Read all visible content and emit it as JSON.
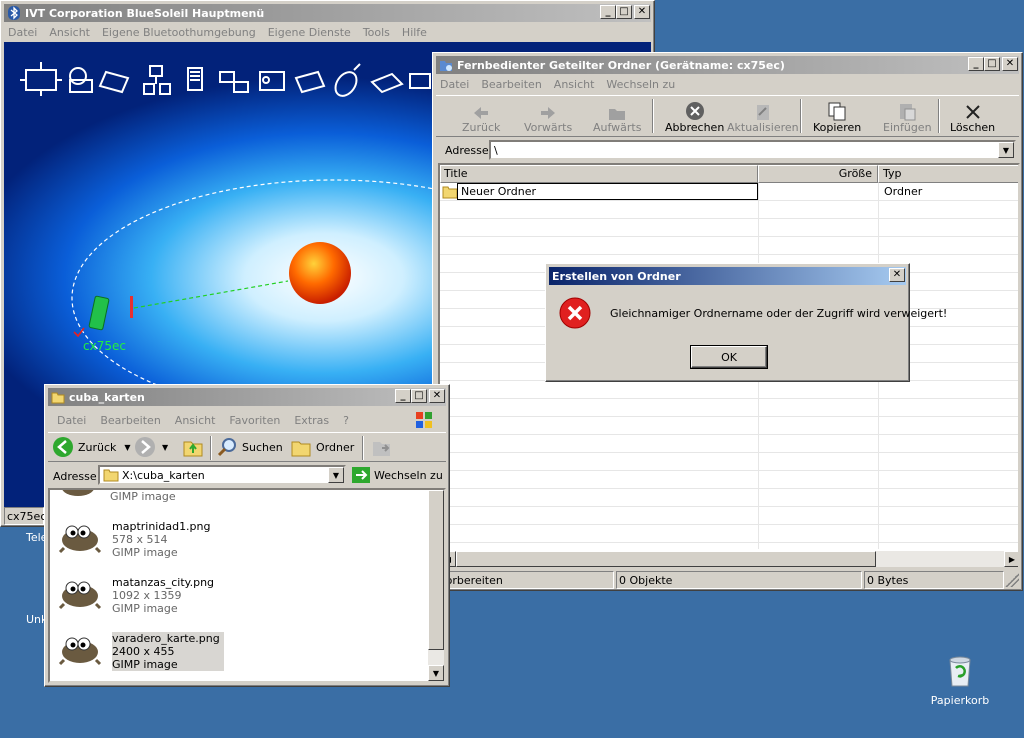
{
  "desktop": {
    "labels": [
      "Tele",
      "Unk"
    ],
    "recycle_bin": "Papierkorb"
  },
  "bluesoleil": {
    "title": "IVT Corporation BlueSoleil Hauptmenü",
    "menu": [
      "Datei",
      "Ansicht",
      "Eigene Bluetoothumgebung",
      "Eigene Dienste",
      "Tools",
      "Hilfe"
    ],
    "device_name": "cx75ec",
    "status": "cx75ec"
  },
  "remote": {
    "title": "Fernbedienter Geteilter Ordner (Gerätname: cx75ec)",
    "menu": [
      "Datei",
      "Bearbeiten",
      "Ansicht",
      "Wechseln zu"
    ],
    "toolbar": {
      "back": "Zurück",
      "forward": "Vorwärts",
      "up": "Aufwärts",
      "cancel": "Abbrechen",
      "refresh": "Aktualisieren",
      "copy": "Kopieren",
      "paste": "Einfügen",
      "delete": "Löschen"
    },
    "address_label": "Adresse",
    "address_value": "\\",
    "columns": {
      "title": "Title",
      "size": "Größe",
      "type": "Typ"
    },
    "rows": [
      {
        "title": "Neuer Ordner",
        "size": "",
        "type": "Ordner"
      }
    ],
    "status": {
      "left": "Vorbereiten",
      "middle": "0 Objekte",
      "right": "0 Bytes"
    }
  },
  "dialog": {
    "title": "Erstellen von Ordner",
    "message": "Gleichnamiger Ordnername oder der Zugriff wird verweigert!",
    "ok": "OK"
  },
  "explorer": {
    "title": "cuba_karten",
    "menu": [
      "Datei",
      "Bearbeiten",
      "Ansicht",
      "Favoriten",
      "Extras",
      "?"
    ],
    "toolbar": {
      "back": "Zurück",
      "search": "Suchen",
      "folders": "Ordner"
    },
    "address_label": "Adresse",
    "address_value": "X:\\cuba_karten",
    "go": "Wechseln zu",
    "partial_file": {
      "type": "GIMP image"
    },
    "files": [
      {
        "name": "maptrinidad1.png",
        "dims": "578 x 514",
        "type": "GIMP image"
      },
      {
        "name": "matanzas_city.png",
        "dims": "1092 x 1359",
        "type": "GIMP image"
      },
      {
        "name": "varadero_karte.png",
        "dims": "2400 x 455",
        "type": "GIMP image"
      }
    ]
  }
}
